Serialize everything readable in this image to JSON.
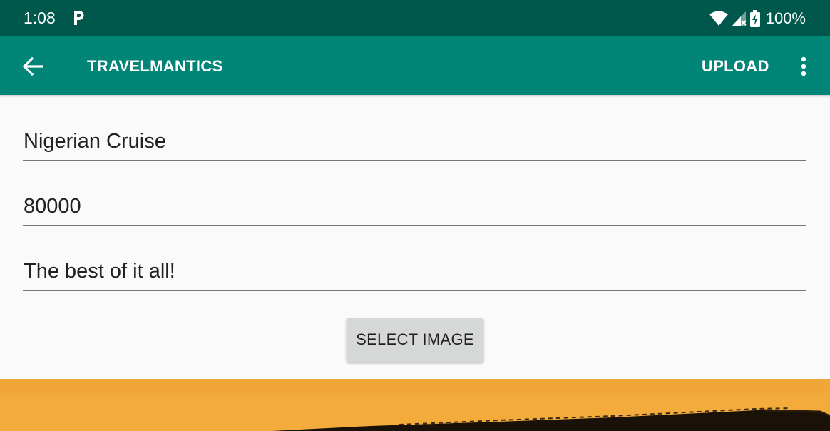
{
  "status_bar": {
    "time": "1:08",
    "battery": "100%",
    "icons": [
      "parking-p-icon",
      "wifi-icon",
      "cell-signal-no-data-icon",
      "battery-charging-icon"
    ]
  },
  "app_bar": {
    "title": "TRAVELMANTICS",
    "upload_label": "UPLOAD",
    "icons": [
      "back-arrow-icon",
      "overflow-menu-icon"
    ]
  },
  "form": {
    "title_value": "Nigerian Cruise",
    "price_value": "80000",
    "description_value": "The best of it all!",
    "select_image_label": "SELECT IMAGE"
  },
  "colors": {
    "status_bar": "#00574b",
    "app_bar": "#008577",
    "background": "#fafafa",
    "button": "#d6d7d7",
    "field_underline": "#777777",
    "image_sky": "#f4ae3e"
  }
}
